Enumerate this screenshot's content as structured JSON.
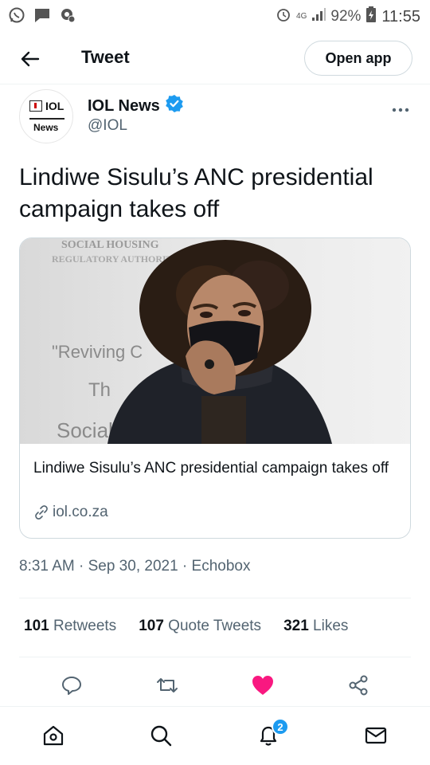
{
  "status_bar": {
    "network": "4G",
    "battery": "92%",
    "time": "11:55",
    "icons": [
      "whatsapp-icon",
      "message-icon",
      "settings-icon",
      "alarm-icon",
      "signal-icon",
      "battery-icon"
    ]
  },
  "header": {
    "title": "Tweet",
    "open_app_label": "Open app"
  },
  "author": {
    "name": "IOL News",
    "handle": "@IOL",
    "verified": true,
    "avatar_logo_top": "IOL",
    "avatar_logo_bottom": "News"
  },
  "tweet": {
    "text": "Lindiwe Sisulu’s ANC presidential campaign takes off",
    "meta": "8:31 AM · Sep 30, 2021 · Echobox"
  },
  "card": {
    "title": "Lindiwe Sisulu’s ANC presidential campaign takes off",
    "domain": "iol.co.za",
    "image_backdrop_text": [
      "SOCIAL HOUSING",
      "REGULATORY AUTHORITY",
      "\"Reviving C",
      "Th",
      "Social"
    ]
  },
  "stats": {
    "retweets_count": "101",
    "retweets_label": "Retweets",
    "quotes_count": "107",
    "quotes_label": "Quote Tweets",
    "likes_count": "321",
    "likes_label": "Likes"
  },
  "bottom_nav": {
    "notification_badge": "2"
  },
  "colors": {
    "accent": "#1d9bf0",
    "like": "#f91880",
    "text": "#0f1419",
    "muted": "#536471",
    "border": "#cfd9de"
  }
}
